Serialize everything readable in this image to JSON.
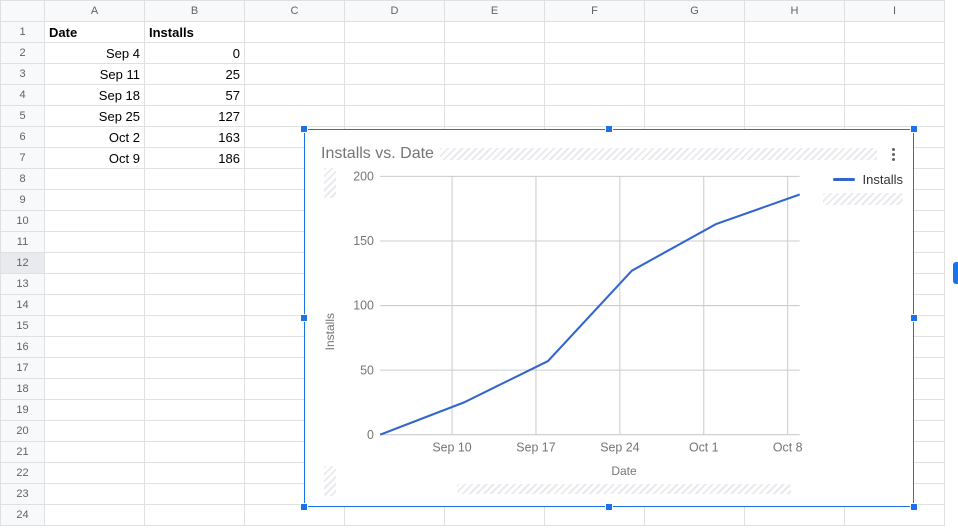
{
  "columns": [
    "A",
    "B",
    "C",
    "D",
    "E",
    "F",
    "G",
    "H",
    "I"
  ],
  "row_count": 24,
  "selected_row": 12,
  "headers": {
    "A": "Date",
    "B": "Installs"
  },
  "rows": [
    {
      "A": "Sep 4",
      "B": "0"
    },
    {
      "A": "Sep 11",
      "B": "25"
    },
    {
      "A": "Sep 18",
      "B": "57"
    },
    {
      "A": "Sep 25",
      "B": "127"
    },
    {
      "A": "Oct 2",
      "B": "163"
    },
    {
      "A": "Oct 9",
      "B": "186"
    }
  ],
  "chart": {
    "title": "Installs vs. Date",
    "xlabel": "Date",
    "ylabel": "Installs",
    "legend": "Installs",
    "y_ticks": [
      0,
      50,
      100,
      150,
      200
    ],
    "x_ticks": [
      "Sep 10",
      "Sep 17",
      "Sep 24",
      "Oct 1",
      "Oct 8"
    ]
  },
  "chart_data": {
    "type": "line",
    "title": "Installs vs. Date",
    "xlabel": "Date",
    "ylabel": "Installs",
    "ylim": [
      0,
      200
    ],
    "series": [
      {
        "name": "Installs",
        "x": [
          "Sep 4",
          "Sep 11",
          "Sep 18",
          "Sep 25",
          "Oct 2",
          "Oct 9"
        ],
        "y": [
          0,
          25,
          57,
          127,
          163,
          186
        ]
      }
    ]
  }
}
